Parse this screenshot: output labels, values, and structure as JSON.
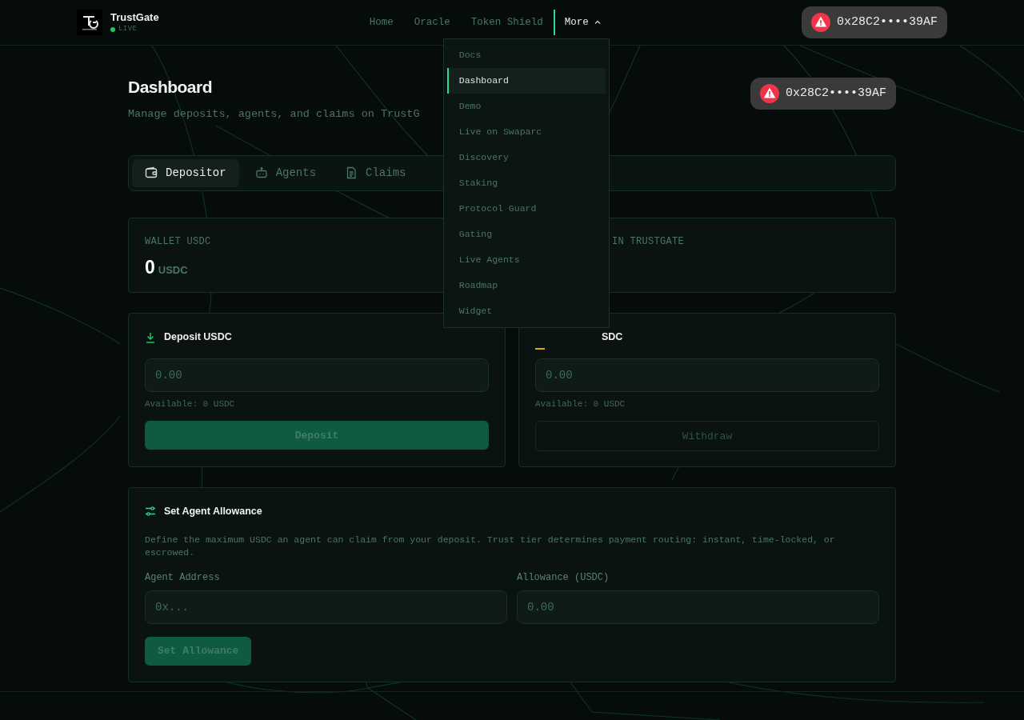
{
  "header": {
    "brand": {
      "name": "TrustGate",
      "status": "LIVE",
      "live": true
    },
    "nav": [
      {
        "label": "Home",
        "kind": "link",
        "selected": false
      },
      {
        "label": "Oracle",
        "kind": "link",
        "selected": false
      },
      {
        "label": "Token Shield",
        "kind": "link",
        "selected": false
      },
      {
        "label": "More",
        "kind": "menu",
        "selected": true,
        "expanded": true
      }
    ],
    "wallet": {
      "address": "0x28C2••••39AF",
      "warning": true
    }
  },
  "more_menu": [
    {
      "label": "Docs",
      "selected": false
    },
    {
      "label": "Dashboard",
      "selected": true
    },
    {
      "label": "Demo",
      "selected": false
    },
    {
      "label": "Live on Swaparc",
      "selected": false
    },
    {
      "label": "Discovery",
      "selected": false
    },
    {
      "label": "Staking",
      "selected": false
    },
    {
      "label": "Protocol Guard",
      "selected": false
    },
    {
      "label": "Gating",
      "selected": false
    },
    {
      "label": "Live Agents",
      "selected": false
    },
    {
      "label": "Roadmap",
      "selected": false
    },
    {
      "label": "Widget",
      "selected": false
    }
  ],
  "page": {
    "title": "Dashboard",
    "subtitle": "Manage deposits, agents, and claims on TrustG",
    "wallet": {
      "address": "0x28C2••••39AF",
      "warning": true
    }
  },
  "tabs": [
    {
      "label": "Depositor",
      "selected": true
    },
    {
      "label": "Agents",
      "selected": false
    },
    {
      "label": "Claims",
      "selected": false
    }
  ],
  "stats": [
    {
      "label": "WALLET USDC",
      "value": "0",
      "unit": "USDC"
    },
    {
      "label": "IN TRUSTGATE"
    }
  ],
  "actions": [
    {
      "kind": "deposit",
      "title": "Deposit USDC",
      "placeholder": "0.00",
      "hint": "Available: 0 USDC",
      "button": "Deposit"
    },
    {
      "kind": "withdraw",
      "title": "SDC",
      "placeholder": "0.00",
      "hint": "Available: 0 USDC",
      "button": "Withdraw"
    }
  ],
  "allowance": {
    "title": "Set Agent Allowance",
    "description": "Define the maximum USDC an agent can claim from your deposit. Trust tier determines payment routing: instant, time-locked, or escrowed.",
    "fields": [
      {
        "label": "Agent Address",
        "placeholder": "0x..."
      },
      {
        "label": "Allowance (USDC)",
        "placeholder": "0.00"
      }
    ],
    "button": "Set Allowance"
  }
}
